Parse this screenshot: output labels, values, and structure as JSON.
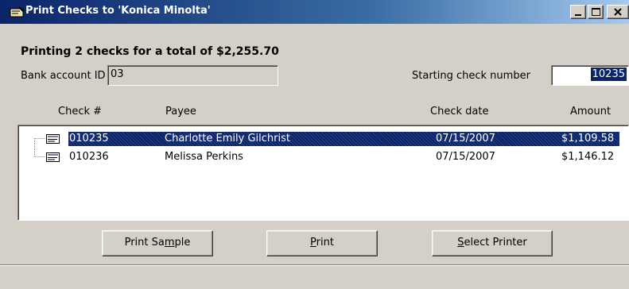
{
  "window": {
    "title": "Print Checks to 'Konica Minolta'",
    "app_icon": "checkbook-icon",
    "controls": {
      "minimize": "minimize-icon",
      "maximize": "maximize-icon",
      "close": "close-icon"
    }
  },
  "summary": {
    "headline": "Printing 2 checks for a total of $2,255.70"
  },
  "bank": {
    "label": "Bank account ID",
    "value": "03"
  },
  "start": {
    "label": "Starting check number",
    "value": "10235"
  },
  "columns": {
    "check": "Check #",
    "payee": "Payee",
    "date": "Check date",
    "amount": "Amount"
  },
  "checks": [
    {
      "number": "010235",
      "payee": "Charlotte Emily Gilchrist",
      "date": "07/15/2007",
      "amount": "$1,109.58",
      "selected": true
    },
    {
      "number": "010236",
      "payee": "Melissa Perkins",
      "date": "07/15/2007",
      "amount": "$1,146.12",
      "selected": false
    }
  ],
  "buttons": {
    "print_sample": {
      "pre": "Print Sa",
      "ul": "m",
      "post": "ple"
    },
    "print": {
      "pre": "",
      "ul": "P",
      "post": "rint"
    },
    "select_printer": {
      "pre": "",
      "ul": "S",
      "post": "elect Printer"
    }
  },
  "colors": {
    "selection": "#0a246a",
    "title_bar": "#0a246a",
    "face": "#d4d0c8"
  }
}
